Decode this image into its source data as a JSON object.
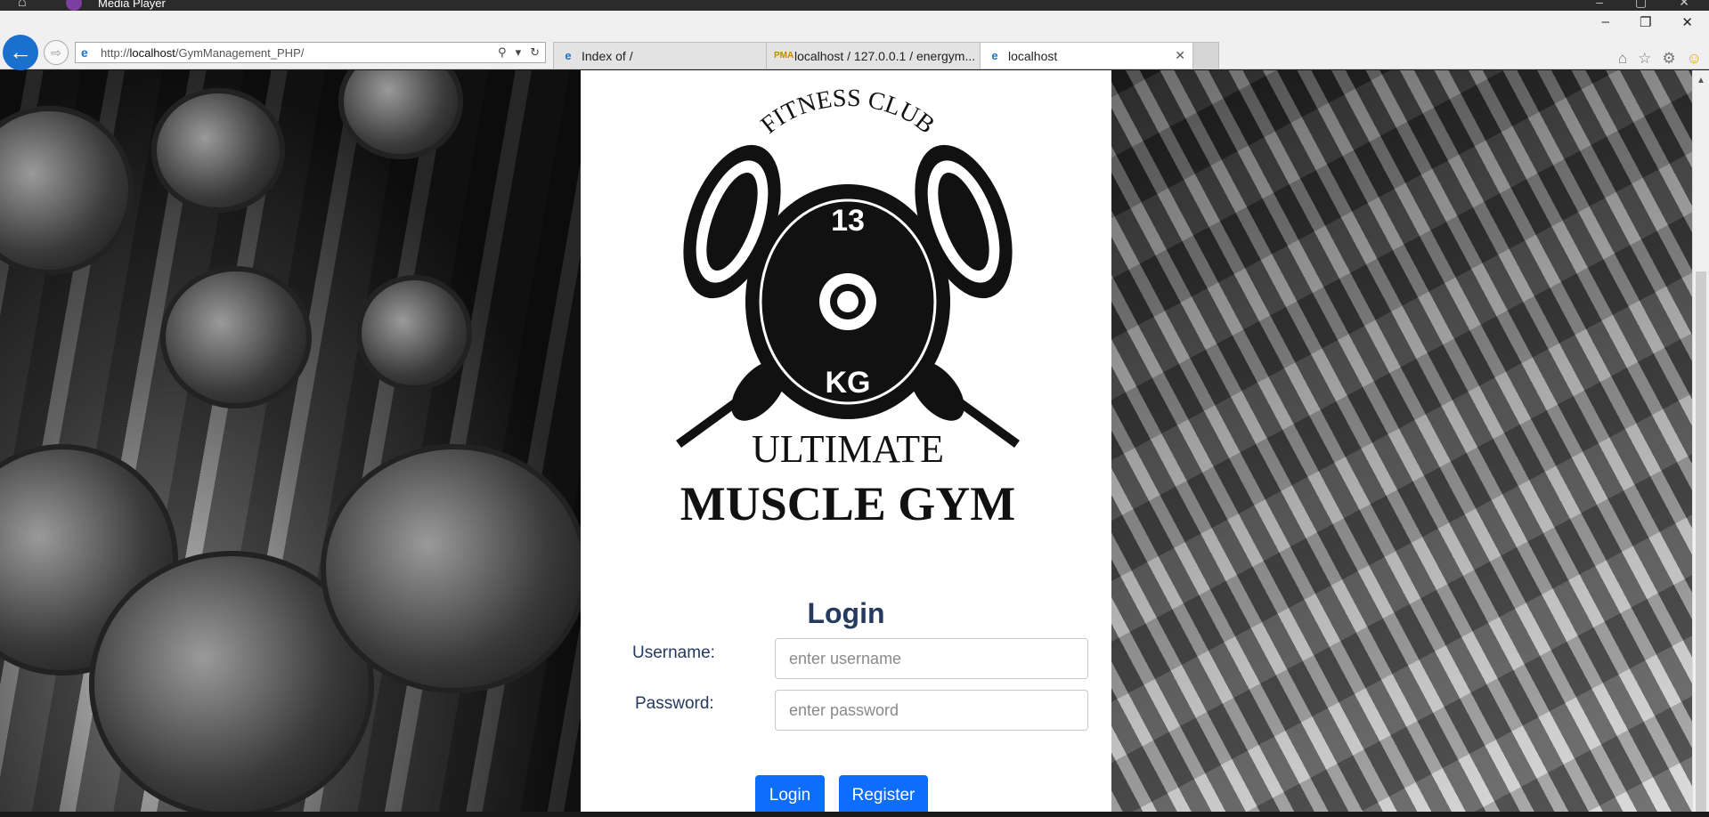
{
  "os": {
    "app_title": "Media Player",
    "controls": [
      "–",
      "▢",
      "✕"
    ]
  },
  "browser": {
    "url_prefix": "http://",
    "url_host": "localhost",
    "url_path": "/GymManagement_PHP/",
    "window_controls": [
      "–",
      "❐",
      "✕"
    ],
    "tabs": [
      {
        "label": "Index of /",
        "icon": "ie-icon",
        "active": false
      },
      {
        "label": "localhost / 127.0.0.1 / energym...",
        "icon": "phpmyadmin-icon",
        "active": false
      },
      {
        "label": "localhost",
        "icon": "ie-icon",
        "active": true
      }
    ],
    "right_icons": [
      "home-icon",
      "star-icon",
      "gear-icon",
      "smiley-icon"
    ]
  },
  "logo": {
    "top_text": "FITNESS CLUB",
    "plate_top": "13",
    "plate_bottom": "KG",
    "line1": "ULTIMATE",
    "line2": "MUSCLE GYM"
  },
  "form": {
    "title": "Login",
    "username_label": "Username:",
    "username_placeholder": "enter username",
    "password_label": "Password:",
    "password_placeholder": "enter password",
    "login_button": "Login",
    "register_button": "Register"
  }
}
